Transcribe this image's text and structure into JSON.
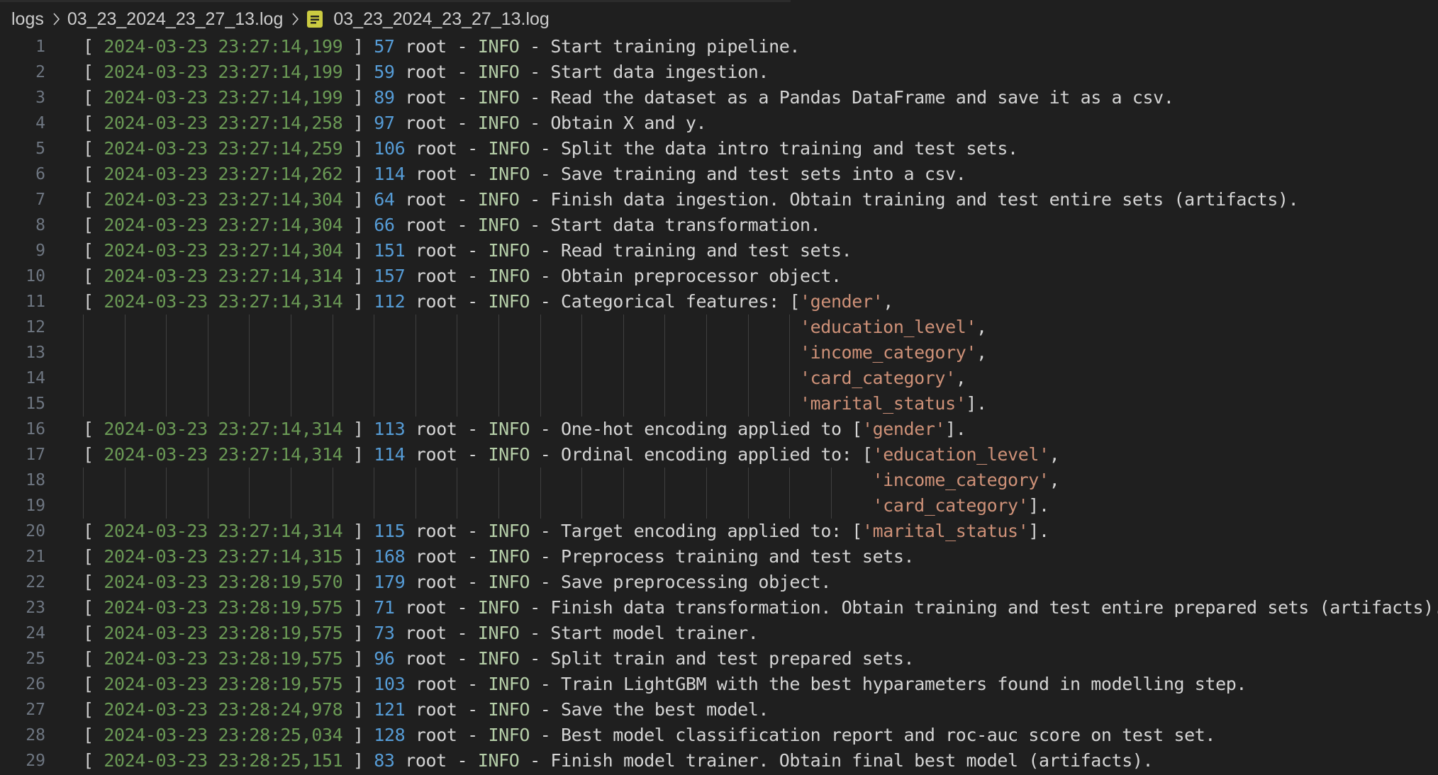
{
  "breadcrumb": {
    "folder": "logs",
    "file_segment": "03_23_2024_23_27_13.log",
    "file_name": "03_23_2024_23_27_13.log"
  },
  "colors": {
    "background": "#1f1f1f",
    "timestamp": "#6a9955",
    "line_ref": "#569cd6",
    "level": "#b5cea8",
    "string": "#ce9178",
    "text": "#d4d4d4",
    "line_number": "#6e7681",
    "file_icon": "#cbcb41"
  },
  "icons": {
    "separator": "chevron-right-icon",
    "file": "log-file-icon"
  },
  "lines": [
    {
      "n": "1",
      "type": "entry",
      "ts": "2024-03-23 23:27:14,199",
      "ref": "57",
      "who": "root",
      "level": "INFO",
      "msg": "Start training pipeline."
    },
    {
      "n": "2",
      "type": "entry",
      "ts": "2024-03-23 23:27:14,199",
      "ref": "59",
      "who": "root",
      "level": "INFO",
      "msg": "Start data ingestion."
    },
    {
      "n": "3",
      "type": "entry",
      "ts": "2024-03-23 23:27:14,199",
      "ref": "89",
      "who": "root",
      "level": "INFO",
      "msg": "Read the dataset as a Pandas DataFrame and save it as a csv."
    },
    {
      "n": "4",
      "type": "entry",
      "ts": "2024-03-23 23:27:14,258",
      "ref": "97",
      "who": "root",
      "level": "INFO",
      "msg": "Obtain X and y."
    },
    {
      "n": "5",
      "type": "entry",
      "ts": "2024-03-23 23:27:14,259",
      "ref": "106",
      "who": "root",
      "level": "INFO",
      "msg": "Split the data intro training and test sets."
    },
    {
      "n": "6",
      "type": "entry",
      "ts": "2024-03-23 23:27:14,262",
      "ref": "114",
      "who": "root",
      "level": "INFO",
      "msg": "Save training and test sets into a csv."
    },
    {
      "n": "7",
      "type": "entry",
      "ts": "2024-03-23 23:27:14,304",
      "ref": "64",
      "who": "root",
      "level": "INFO",
      "msg": "Finish data ingestion. Obtain training and test entire sets (artifacts)."
    },
    {
      "n": "8",
      "type": "entry",
      "ts": "2024-03-23 23:27:14,304",
      "ref": "66",
      "who": "root",
      "level": "INFO",
      "msg": "Start data transformation."
    },
    {
      "n": "9",
      "type": "entry",
      "ts": "2024-03-23 23:27:14,304",
      "ref": "151",
      "who": "root",
      "level": "INFO",
      "msg": "Read training and test sets."
    },
    {
      "n": "10",
      "type": "entry",
      "ts": "2024-03-23 23:27:14,314",
      "ref": "157",
      "who": "root",
      "level": "INFO",
      "msg": "Obtain preprocessor object."
    },
    {
      "n": "11",
      "type": "entry",
      "ts": "2024-03-23 23:27:14,314",
      "ref": "112",
      "who": "root",
      "level": "INFO",
      "msg": "Categorical features: [",
      "str": "'gender'",
      "tail": ","
    },
    {
      "n": "12",
      "type": "cont",
      "group": "a",
      "str": "'education_level'",
      "tail": ","
    },
    {
      "n": "13",
      "type": "cont",
      "group": "a",
      "str": "'income_category'",
      "tail": ","
    },
    {
      "n": "14",
      "type": "cont",
      "group": "a",
      "str": "'card_category'",
      "tail": ","
    },
    {
      "n": "15",
      "type": "cont",
      "group": "a",
      "str": "'marital_status'",
      "tail": "]."
    },
    {
      "n": "16",
      "type": "entry",
      "ts": "2024-03-23 23:27:14,314",
      "ref": "113",
      "who": "root",
      "level": "INFO",
      "msg": "One-hot encoding applied to [",
      "str": "'gender'",
      "tail": "]."
    },
    {
      "n": "17",
      "type": "entry",
      "ts": "2024-03-23 23:27:14,314",
      "ref": "114",
      "who": "root",
      "level": "INFO",
      "msg": "Ordinal encoding applied to: [",
      "str": "'education_level'",
      "tail": ","
    },
    {
      "n": "18",
      "type": "cont",
      "group": "b",
      "str": "'income_category'",
      "tail": ","
    },
    {
      "n": "19",
      "type": "cont",
      "group": "b",
      "str": "'card_category'",
      "tail": "]."
    },
    {
      "n": "20",
      "type": "entry",
      "ts": "2024-03-23 23:27:14,314",
      "ref": "115",
      "who": "root",
      "level": "INFO",
      "msg": "Target encoding applied to: [",
      "str": "'marital_status'",
      "tail": "]."
    },
    {
      "n": "21",
      "type": "entry",
      "ts": "2024-03-23 23:27:14,315",
      "ref": "168",
      "who": "root",
      "level": "INFO",
      "msg": "Preprocess training and test sets."
    },
    {
      "n": "22",
      "type": "entry",
      "ts": "2024-03-23 23:28:19,570",
      "ref": "179",
      "who": "root",
      "level": "INFO",
      "msg": "Save preprocessing object."
    },
    {
      "n": "23",
      "type": "entry",
      "ts": "2024-03-23 23:28:19,575",
      "ref": "71",
      "who": "root",
      "level": "INFO",
      "msg": "Finish data transformation. Obtain training and test entire prepared sets (artifacts)."
    },
    {
      "n": "24",
      "type": "entry",
      "ts": "2024-03-23 23:28:19,575",
      "ref": "73",
      "who": "root",
      "level": "INFO",
      "msg": "Start model trainer."
    },
    {
      "n": "25",
      "type": "entry",
      "ts": "2024-03-23 23:28:19,575",
      "ref": "96",
      "who": "root",
      "level": "INFO",
      "msg": "Split train and test prepared sets."
    },
    {
      "n": "26",
      "type": "entry",
      "ts": "2024-03-23 23:28:19,575",
      "ref": "103",
      "who": "root",
      "level": "INFO",
      "msg": "Train LightGBM with the best hyparameters found in modelling step."
    },
    {
      "n": "27",
      "type": "entry",
      "ts": "2024-03-23 23:28:24,978",
      "ref": "121",
      "who": "root",
      "level": "INFO",
      "msg": "Save the best model."
    },
    {
      "n": "28",
      "type": "entry",
      "ts": "2024-03-23 23:28:25,034",
      "ref": "128",
      "who": "root",
      "level": "INFO",
      "msg": "Best model classification report and roc-auc score on test set."
    },
    {
      "n": "29",
      "type": "entry",
      "ts": "2024-03-23 23:28:25,151",
      "ref": "83",
      "who": "root",
      "level": "INFO",
      "msg": "Finish model trainer. Obtain final best model (artifacts)."
    }
  ]
}
